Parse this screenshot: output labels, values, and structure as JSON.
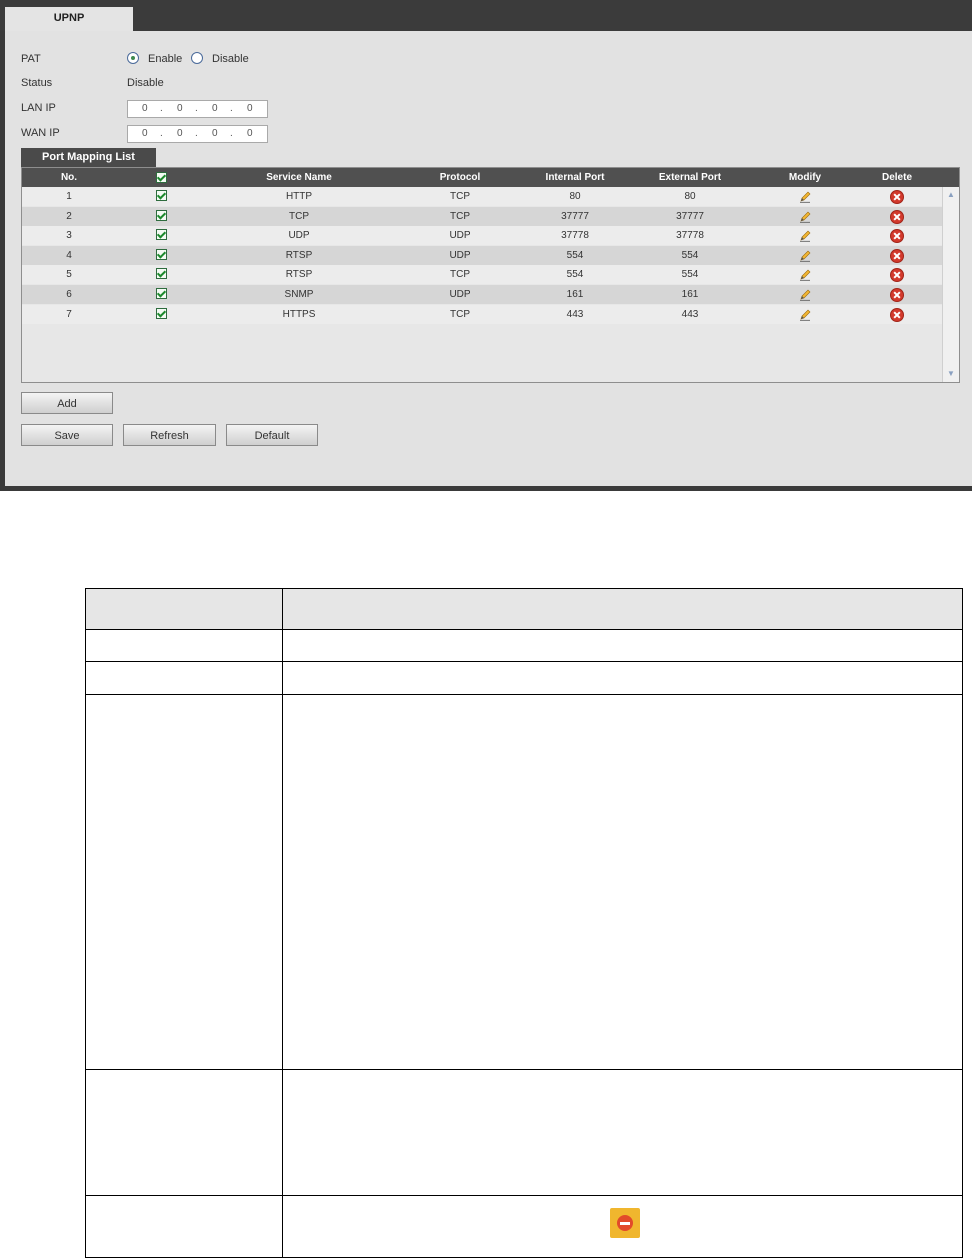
{
  "window": {
    "tab_label": "UPNP"
  },
  "form": {
    "pat_label": "PAT",
    "pat_options": [
      "Enable",
      "Disable"
    ],
    "pat_selected": "Enable",
    "status_label": "Status",
    "status_value": "Disable",
    "lan_ip_label": "LAN IP",
    "lan_ip": [
      "0",
      "0",
      "0",
      "0"
    ],
    "wan_ip_label": "WAN IP",
    "wan_ip": [
      "0",
      "0",
      "0",
      "0"
    ]
  },
  "port_mapping": {
    "tab_label": "Port Mapping List",
    "columns": [
      "No.",
      "",
      "Service Name",
      "Protocol",
      "Internal Port",
      "External Port",
      "Modify",
      "Delete"
    ],
    "rows": [
      {
        "no": "1",
        "service": "HTTP",
        "protocol": "TCP",
        "internal": "80",
        "external": "80"
      },
      {
        "no": "2",
        "service": "TCP",
        "protocol": "TCP",
        "internal": "37777",
        "external": "37777"
      },
      {
        "no": "3",
        "service": "UDP",
        "protocol": "UDP",
        "internal": "37778",
        "external": "37778"
      },
      {
        "no": "4",
        "service": "RTSP",
        "protocol": "UDP",
        "internal": "554",
        "external": "554"
      },
      {
        "no": "5",
        "service": "RTSP",
        "protocol": "TCP",
        "internal": "554",
        "external": "554"
      },
      {
        "no": "6",
        "service": "SNMP",
        "protocol": "UDP",
        "internal": "161",
        "external": "161"
      },
      {
        "no": "7",
        "service": "HTTPS",
        "protocol": "TCP",
        "internal": "443",
        "external": "443"
      }
    ]
  },
  "buttons": {
    "add": "Add",
    "save": "Save",
    "refresh": "Refresh",
    "default": "Default"
  },
  "icons": {
    "modify": "pencil-icon",
    "delete": "delete-icon",
    "checkbox": "checkbox-checked-icon",
    "inline_table_icon": "stop-icon"
  },
  "colors": {
    "header_bar": "#505050",
    "panel_bg": "#e2e2e2",
    "delete_red": "#d2392c",
    "check_green": "#1c8a2c"
  }
}
